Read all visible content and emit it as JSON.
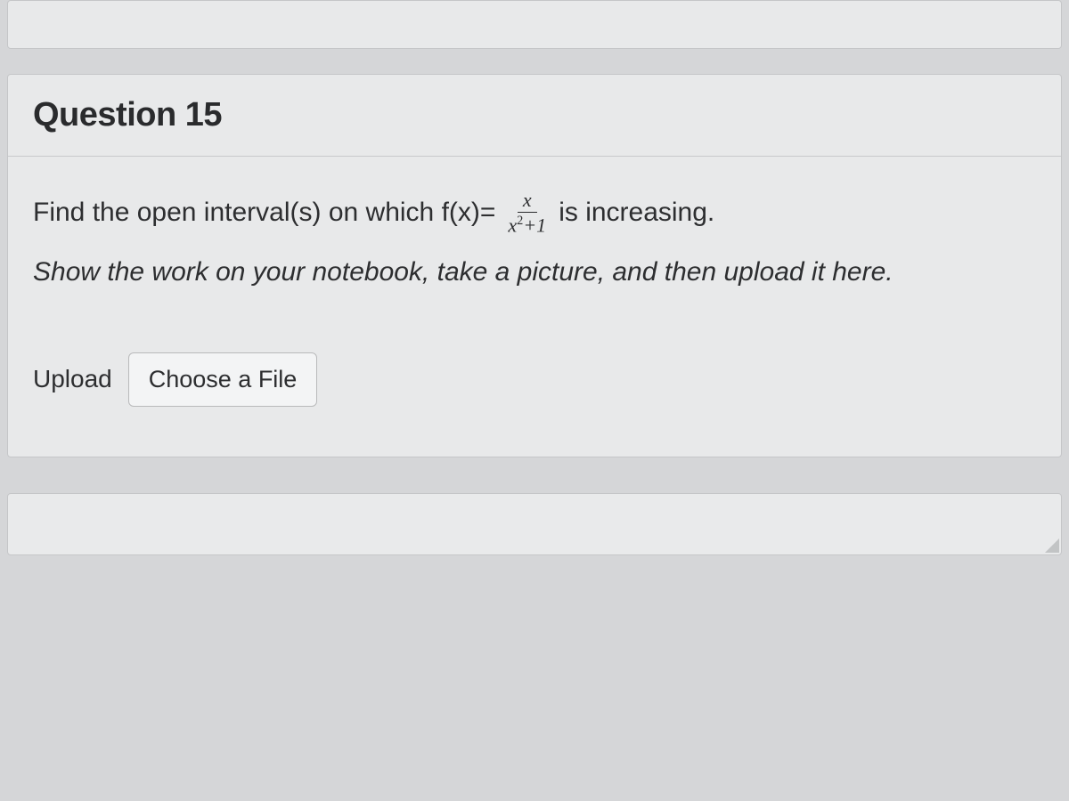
{
  "question": {
    "title": "Question 15",
    "prompt_part1": "Find the open interval(s) on which f(x)=",
    "prompt_part2": "is increasing.",
    "fraction": {
      "numerator": "x",
      "denominator_var": "x",
      "denominator_exp": "2",
      "denominator_plus": "+1"
    },
    "instruction": "Show the work on your notebook, take a picture, and then upload it here.",
    "upload_label": "Upload",
    "file_button": "Choose a File"
  }
}
